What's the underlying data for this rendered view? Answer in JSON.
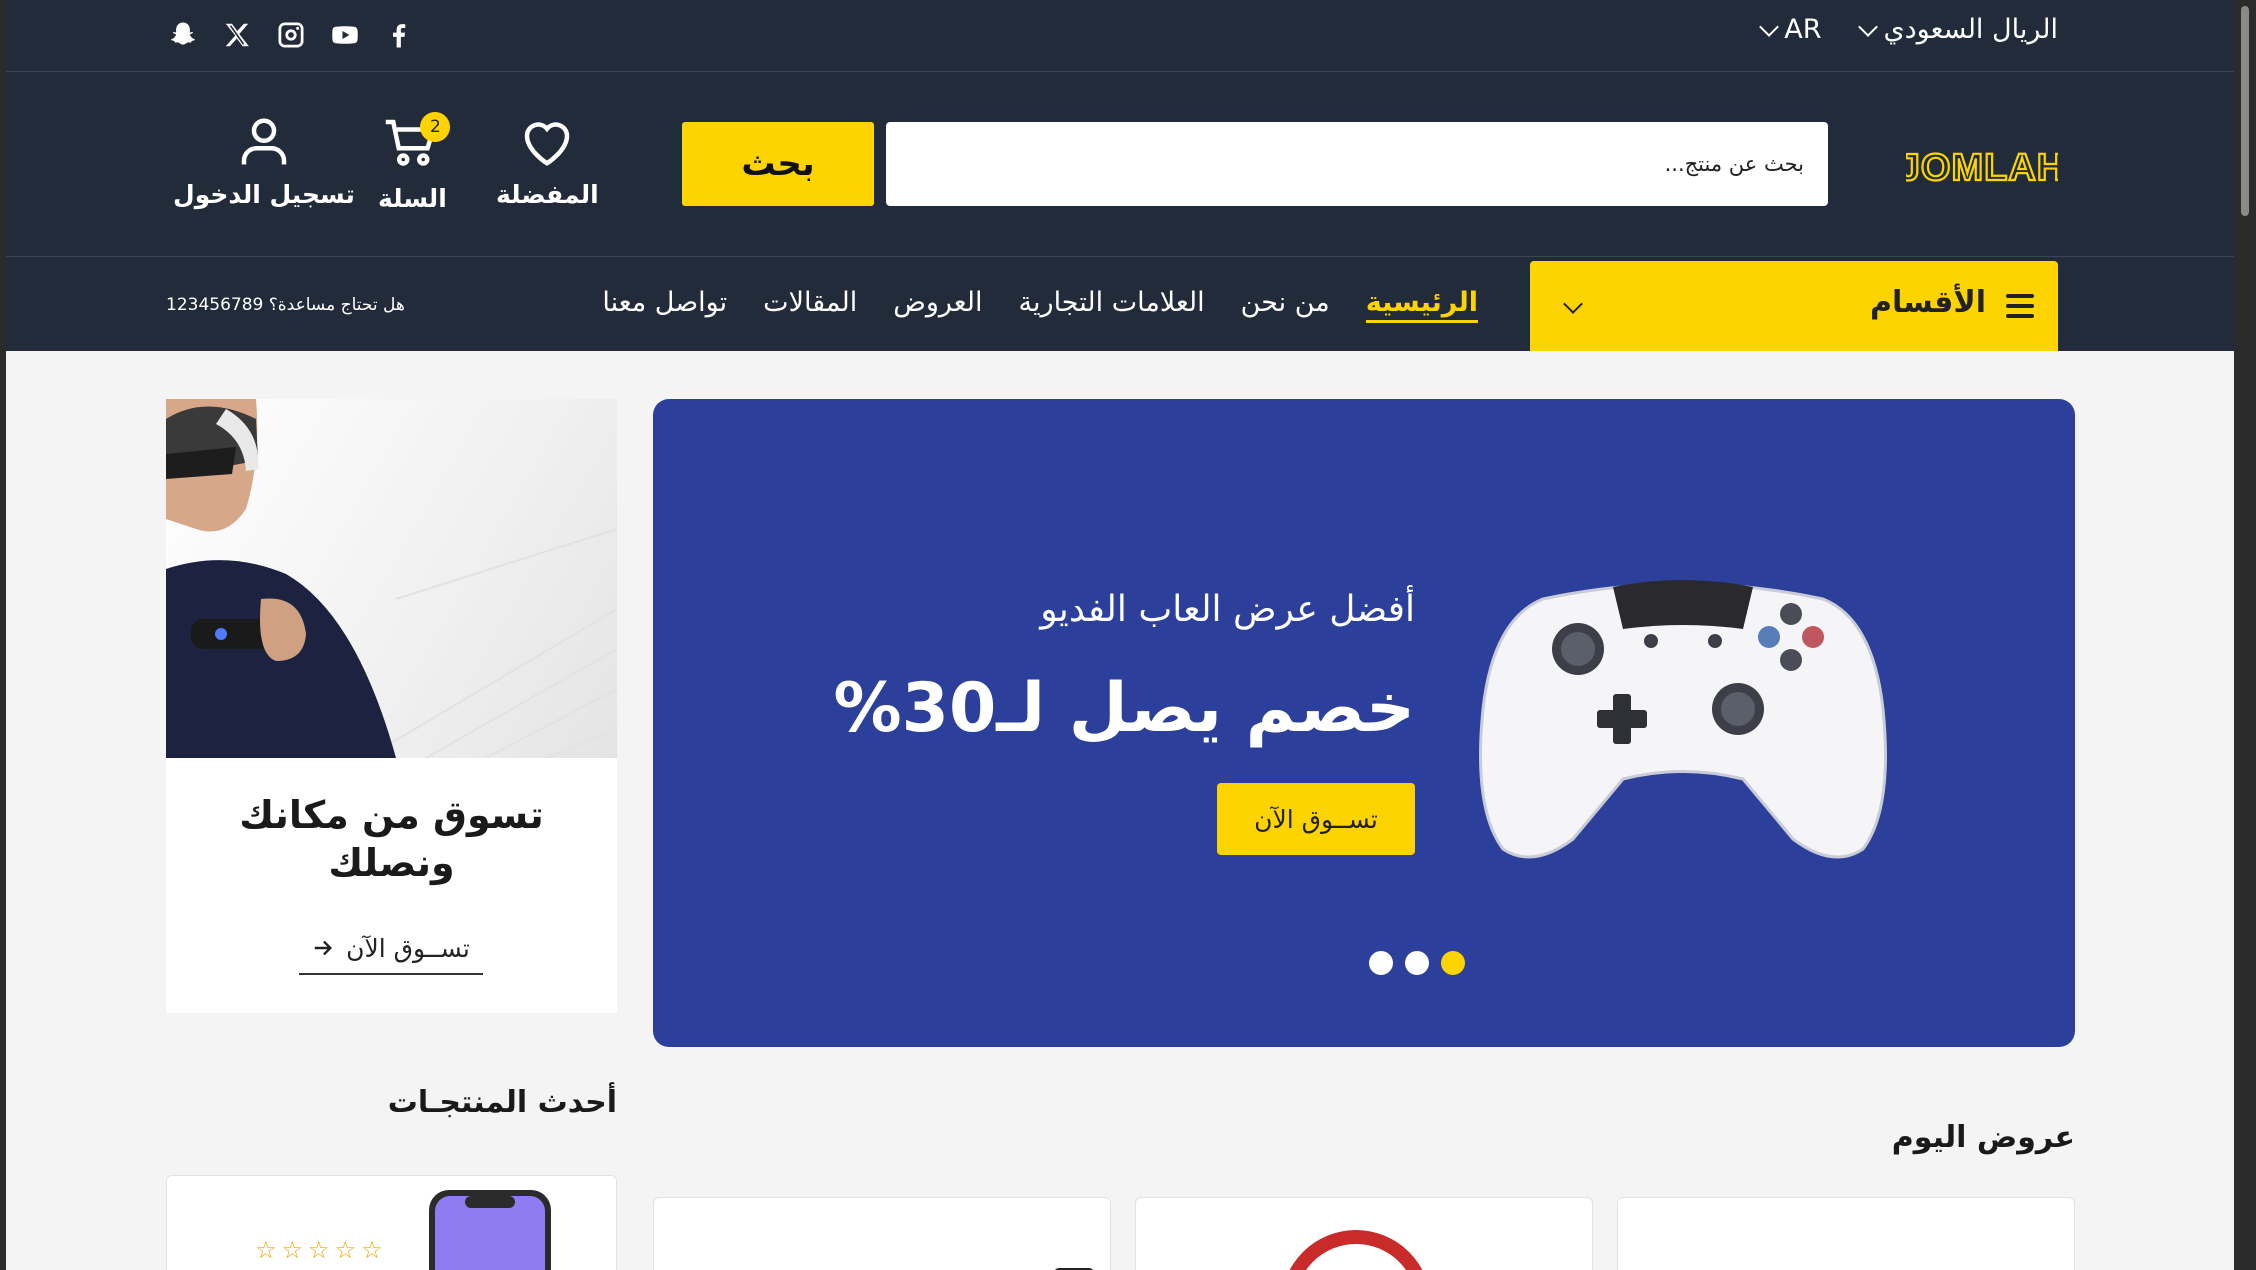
{
  "topbar": {
    "currency": "الريال السعودي",
    "language": "AR",
    "social": [
      "facebook-icon",
      "youtube-icon",
      "instagram-icon",
      "x-icon",
      "snapchat-icon"
    ]
  },
  "header": {
    "logo_text": "JOMLAH",
    "search_placeholder": "بحث عن منتج...",
    "search_button": "بحث",
    "wishlist_label": "المفضلة",
    "cart_label": "السلة",
    "cart_count": "2",
    "login_label": "تسجيل الدخول"
  },
  "nav": {
    "categories_label": "الأقسام",
    "links": [
      "الرئيسية",
      "من نحن",
      "العلامات التجارية",
      "العروض",
      "المقالات",
      "تواصل معنا"
    ],
    "active_index": 0,
    "help_text": "هل تحتاج مساعدة؟ 123456789"
  },
  "hero": {
    "subtitle": "أفضل عرض العاب الفديو",
    "headline": "خصم يصل لـ30%",
    "cta": "تســوق الآن",
    "slides": 3,
    "active_slide": 0
  },
  "side_promo": {
    "title_line1": "تسوق من مكانك",
    "title_line2": "ونصلك",
    "link": "تســوق الآن"
  },
  "sections": {
    "latest_products": "أحدث المنتجـات",
    "todays_offers": "عروض اليوم"
  },
  "colors": {
    "dark_bg": "#222b39",
    "accent": "#fdd400",
    "hero_bg": "#2b3f9b"
  }
}
